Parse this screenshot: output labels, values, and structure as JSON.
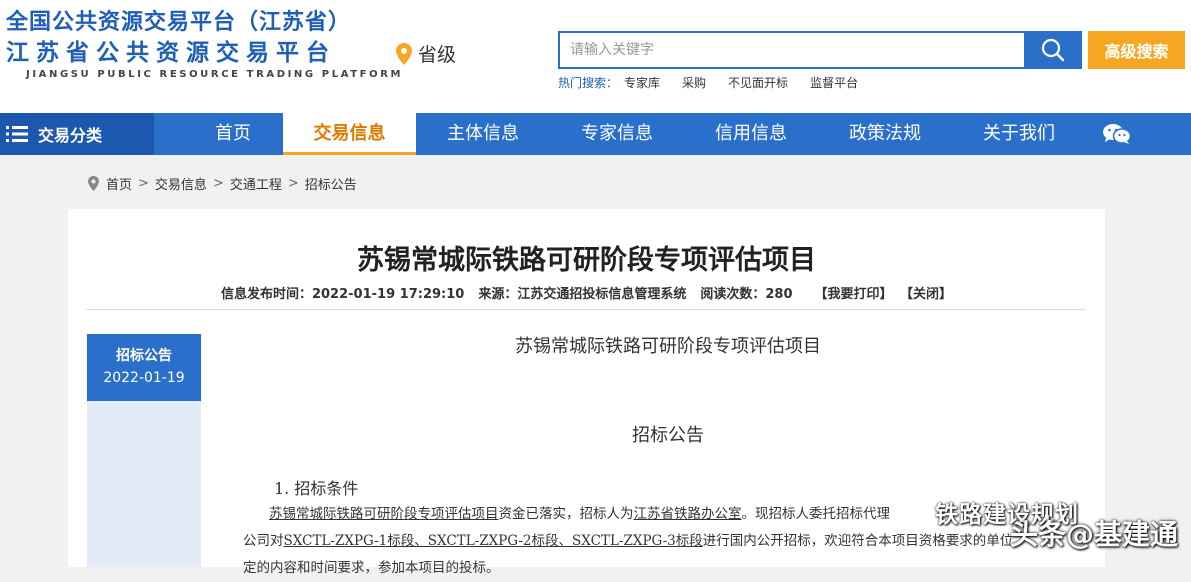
{
  "header": {
    "logo_line1": "全国公共资源交易平台（江苏省）",
    "logo_line2": "江苏省公共资源交易平台",
    "logo_line3": "JIANGSU PUBLIC RESOURCE TRADING PLATFORM",
    "region_label": "省级",
    "search_placeholder": "请输入关键字",
    "advanced_search_label": "高级搜索",
    "hot_label": "热门搜索：",
    "hot_items": [
      "专家库",
      "采购",
      "不见面开标",
      "监督平台"
    ]
  },
  "nav": {
    "category_label": "交易分类",
    "items": [
      "首页",
      "交易信息",
      "主体信息",
      "专家信息",
      "信用信息",
      "政策法规",
      "关于我们"
    ],
    "active_index": 1
  },
  "breadcrumb": [
    "首页",
    "交易信息",
    "交通工程",
    "招标公告"
  ],
  "article": {
    "title": "苏锡常城际铁路可研阶段专项评估项目",
    "publish_label": "信息发布时间：",
    "publish_time": "2022-01-19 17:29:10",
    "source_label": "来源：",
    "source": "江苏交通招投标信息管理系统",
    "views_label": "阅读次数：",
    "views": "280",
    "print_label": "【我要打印】",
    "close_label": "【关闭】"
  },
  "side": {
    "category": "招标公告",
    "date": "2022-01-19"
  },
  "document": {
    "title": "苏锡常城际铁路可研阶段专项评估项目",
    "subtitle": "招标公告",
    "section1": "1. 招标条件",
    "para1_a": "苏锡常城际铁路可研阶段专项评估项目",
    "para1_b": "资金已落实，招标人为",
    "para1_c": "江苏省铁路办公室",
    "para1_d": "。现招标人委托招标代理",
    "para2_a": "公司对",
    "para2_b": "SXCTL-ZXPG-1标段、SXCTL-ZXPG-2标段、SXCTL-ZXPG-3标段",
    "para2_c": "进行国内公开招标，欢迎符合本项目资格要求的单位",
    "para3": "定的内容和时间要求，参加本项目的投标。"
  },
  "watermark": {
    "line1": "铁路建设规划",
    "line2": "头条@基建通"
  }
}
